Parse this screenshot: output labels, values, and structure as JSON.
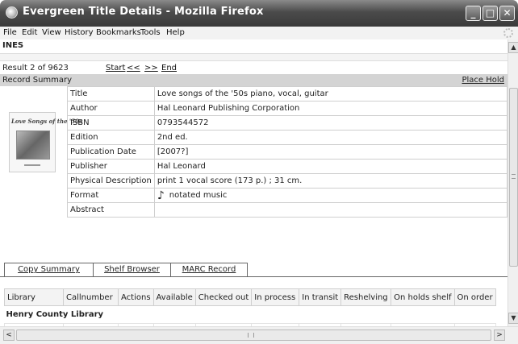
{
  "window": {
    "title": "Evergreen Title Details - Mozilla Firefox",
    "controls": {
      "minimize": "_",
      "maximize": "□",
      "close": "✕"
    }
  },
  "menubar": {
    "items": [
      "File",
      "Edit",
      "View",
      "History",
      "Bookmarks",
      "Tools",
      "Help"
    ]
  },
  "page": {
    "org": "INES",
    "result_count": "Result 2 of 9623",
    "nav": {
      "start": "Start",
      "prev": "<<",
      "next": ">>",
      "end": "End"
    },
    "summary_label": "Record Summary",
    "place_hold": "Place Hold",
    "cover": {
      "title": "Love Songs of the '50s"
    },
    "record": [
      {
        "label": "Title",
        "value": "Love songs of the '50s piano, vocal, guitar"
      },
      {
        "label": "Author",
        "value": "Hal Leonard Publishing Corporation"
      },
      {
        "label": "ISBN",
        "value": "0793544572"
      },
      {
        "label": "Edition",
        "value": "2nd ed."
      },
      {
        "label": "Publication Date",
        "value": "[2007?]"
      },
      {
        "label": "Publisher",
        "value": "Hal Leonard"
      },
      {
        "label": "Physical Description",
        "value": "print 1 vocal score (173 p.) ; 31 cm."
      },
      {
        "label": "Format",
        "value": "notated music",
        "icon": "music-note-icon"
      },
      {
        "label": "Abstract",
        "value": ""
      }
    ],
    "tabs": [
      "Copy Summary",
      "Shelf Browser",
      "MARC Record"
    ],
    "copies": {
      "columns": [
        "Library",
        "Callnumber",
        "Actions",
        "Available",
        "Checked out",
        "In process",
        "In transit",
        "Reshelving",
        "On holds shelf",
        "On order"
      ],
      "library": "Henry County Library"
    }
  },
  "scrollbars": {
    "up": "▲",
    "down": "▼",
    "left": "<",
    "right": ">"
  }
}
